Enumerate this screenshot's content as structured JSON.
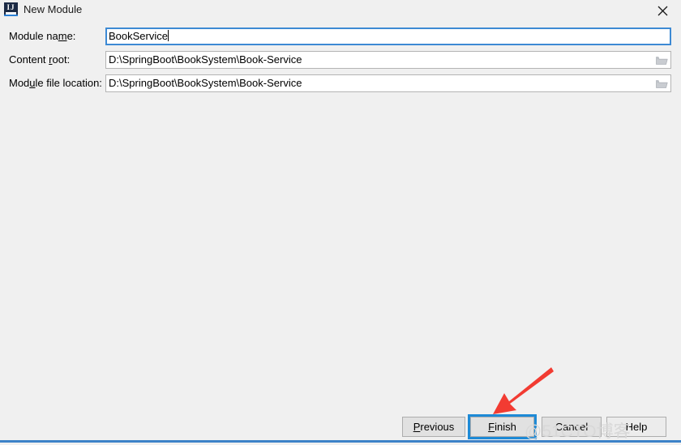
{
  "window": {
    "title": "New Module",
    "app_icon": "intellij-idea-icon",
    "icon_letters": "IJ",
    "close_label": "✕",
    "background_color": "#f0f0f0"
  },
  "form": {
    "rows": [
      {
        "label_before": "Module na",
        "label_mnemonic": "m",
        "label_after": "e:",
        "name": "module-name",
        "value": "BookService",
        "placeholder": "",
        "focused": true,
        "has_browse": false
      },
      {
        "label_before": "Content ",
        "label_mnemonic": "r",
        "label_after": "oot:",
        "name": "content-root",
        "value": "D:\\SpringBoot\\BookSystem\\Book-Service",
        "placeholder": "",
        "focused": false,
        "has_browse": true
      },
      {
        "label_before": "Mod",
        "label_mnemonic": "u",
        "label_after": "le file location:",
        "name": "module-file-location",
        "value": "D:\\SpringBoot\\BookSystem\\Book-Service",
        "placeholder": "",
        "focused": false,
        "has_browse": true
      }
    ],
    "browse_icon": "folder-icon"
  },
  "buttons": {
    "previous": {
      "before": "",
      "mnemonic": "P",
      "after": "revious"
    },
    "finish": {
      "before": "",
      "mnemonic": "F",
      "after": "inish",
      "default_focused": true
    },
    "cancel": {
      "label": "Cancel"
    },
    "help": {
      "label": "Help"
    }
  },
  "annotations": {
    "arrow_color": "#f23b32",
    "arrow_name": "red-pointer-arrow",
    "watermark_text": "@51CTO博客"
  },
  "colors": {
    "focus_blue": "#1e8ad6",
    "field_border": "#b4b4b4",
    "bottom_rule": "#3d82c8",
    "button_face": "#e1e1e1"
  }
}
